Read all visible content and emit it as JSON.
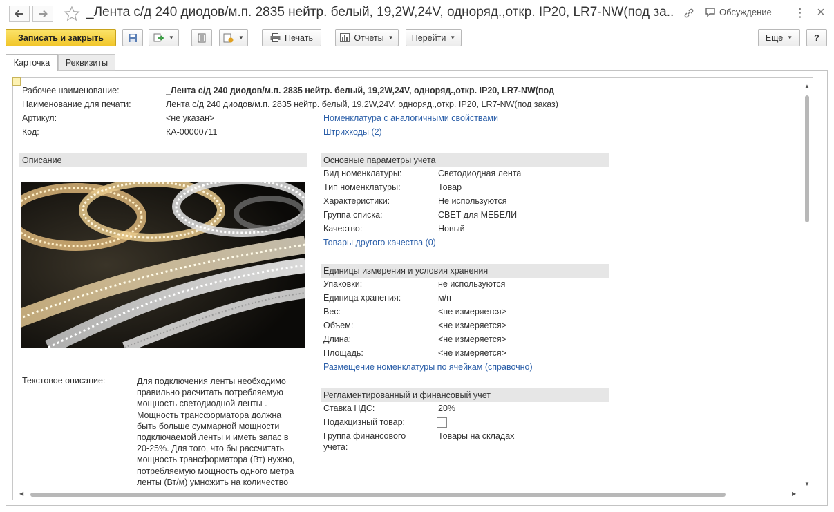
{
  "window": {
    "title": "_Лента с/д 240 диодов/м.п. 2835 нейтр. белый, 19,2W,24V, однoряд.,откр. IP20, LR7-NW(под за...",
    "discussion_label": "Обсуждение",
    "close_glyph": "×",
    "more_glyph": "⋮"
  },
  "toolbar": {
    "save_close_label": "Записать и закрыть",
    "print_label": "Печать",
    "reports_label": "Отчеты",
    "goto_label": "Перейти",
    "more_label": "Еще",
    "help_label": "?"
  },
  "tabs": [
    {
      "label": "Карточка",
      "active": true
    },
    {
      "label": "Реквизиты",
      "active": false
    }
  ],
  "header_fields": {
    "work_name_label": "Рабочее наименование:",
    "work_name_value": "_Лента с/д 240 диодов/м.п. 2835 нейтр. белый, 19,2W,24V, однoряд.,откр. IP20, LR7-NW(под",
    "print_name_label": "Наименование для печати:",
    "print_name_value": "Лента с/д 240 диодов/м.п. 2835 нейтр. белый, 19,2W,24V, однoряд.,откр. IP20, LR7-NW(под заказ)",
    "article_label": "Артикул:",
    "article_value": "<не указан>",
    "code_label": "Код:",
    "code_value": "КА-00000711",
    "similar_link": "Номенклатура с аналогичными свойствами",
    "barcodes_link": "Штрихкоды (2)"
  },
  "description": {
    "section_title": "Описание",
    "text_label": "Текстовое описание:",
    "text_lines": [
      "Для подключения ленты необходимо",
      "правильно расчитать потребляемую",
      "мощность светодиодной ленты .",
      "Мощность трансформатора должна",
      "быть больше суммарной мощности",
      "подключаемой ленты и иметь запас в",
      "20-25%. Для того, что бы рассчитать",
      "мощность трансформатора (Вт) нужно,",
      "потребляемую мощность одного метра",
      "ленты (Вт/м) умножить на количество"
    ]
  },
  "main_params": {
    "section_title": "Основные параметры учета",
    "rows": [
      {
        "label": "Вид номенклатуры:",
        "value": "Светодиодная лента"
      },
      {
        "label": "Тип номенклатуры:",
        "value": "Товар"
      },
      {
        "label": "Характеристики:",
        "value": "Не используются"
      },
      {
        "label": "Группа списка:",
        "value": "СВЕТ для МЕБЕЛИ"
      },
      {
        "label": "Качество:",
        "value": "Новый"
      }
    ],
    "link": "Товары другого качества (0)"
  },
  "units": {
    "section_title": "Единицы измерения и условия хранения",
    "rows": [
      {
        "label": "Упаковки:",
        "value": "не используются"
      },
      {
        "label": "Единица хранения:",
        "value": "м/п"
      },
      {
        "label": "Вес:",
        "value": "<не измеряется>"
      },
      {
        "label": "Объем:",
        "value": "<не измеряется>"
      },
      {
        "label": "Длина:",
        "value": "<не измеряется>"
      },
      {
        "label": "Площадь:",
        "value": "<не измеряется>"
      }
    ],
    "link": "Размещение номенклатуры по ячейкам (справочно)"
  },
  "finance": {
    "section_title": "Регламентированный и финансовый учет",
    "vat_label": "Ставка НДС:",
    "vat_value": "20%",
    "excise_label": "Подакцизный товар:",
    "excise_checked": false,
    "fin_group_label_1": "Группа финансового",
    "fin_group_label_2": "учета:",
    "fin_group_value": "Товары на складах"
  }
}
